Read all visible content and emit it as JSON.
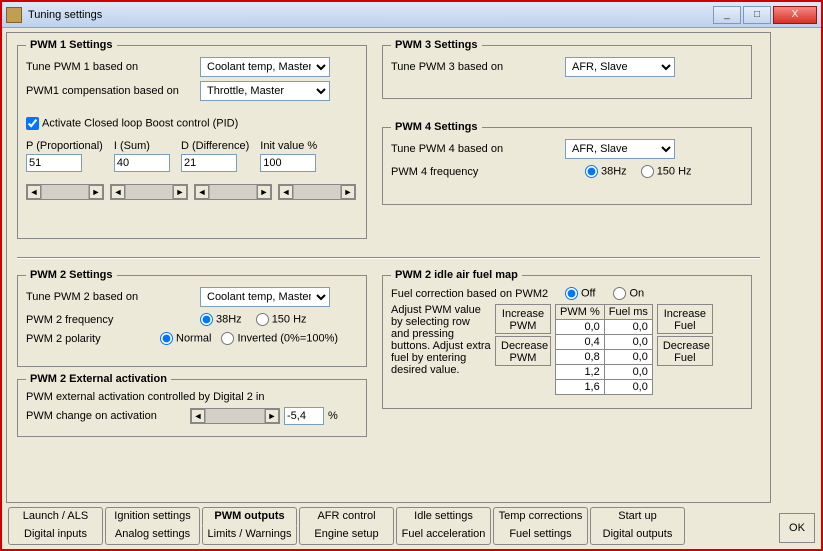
{
  "window": {
    "title": "Tuning settings",
    "buttons": {
      "min": "_",
      "max": "□",
      "close": "X"
    }
  },
  "pwm1": {
    "legend": "PWM 1 Settings",
    "baseLabel": "Tune PWM 1 based on",
    "baseValue": "Coolant temp, Master",
    "compLabel": "PWM1 compensation based on",
    "compValue": "Throttle, Master",
    "activateLabel": "Activate Closed loop Boost control  (PID)",
    "pid": {
      "p": {
        "label": "P (Proportional)",
        "value": "51"
      },
      "i": {
        "label": "I (Sum)",
        "value": "40"
      },
      "d": {
        "label": "D (Difference)",
        "value": "21"
      },
      "init": {
        "label": "Init value %",
        "value": "100"
      }
    }
  },
  "pwm3": {
    "legend": "PWM 3 Settings",
    "baseLabel": "Tune PWM 3 based on",
    "baseValue": "AFR, Slave"
  },
  "pwm4": {
    "legend": "PWM 4 Settings",
    "baseLabel": "Tune PWM 4 based on",
    "baseValue": "AFR, Slave",
    "freqLabel": "PWM 4 frequency",
    "freqOptions": {
      "a": "38Hz",
      "b": "150 Hz"
    }
  },
  "pwm2": {
    "legend": "PWM 2 Settings",
    "baseLabel": "Tune PWM 2 based on",
    "baseValue": "Coolant temp, Master",
    "freqLabel": "PWM 2 frequency",
    "freqOptions": {
      "a": "38Hz",
      "b": "150 Hz"
    },
    "polLabel": "PWM 2 polarity",
    "polOptions": {
      "a": "Normal",
      "b": "Inverted (0%=100%)"
    }
  },
  "pwm2ext": {
    "legend": "PWM 2 External activation",
    "desc": "PWM external activation controlled by Digital 2 in",
    "changeLabel": "PWM change on activation",
    "value": "-5,4",
    "unit": "%"
  },
  "pwm2idle": {
    "legend": "PWM 2 idle air fuel map",
    "corrLabel": "Fuel correction based on PWM2",
    "corrOptions": {
      "off": "Off",
      "on": "On"
    },
    "help1": "Adjust PWM value by selecting row and pressing buttons.",
    "help2": " Adjust extra fuel by entering desired value.",
    "btnIncP": "Increase PWM",
    "btnDecP": "Decrease PWM",
    "btnIncF": "Increase Fuel",
    "btnDecF": "Decrease Fuel",
    "headers": {
      "col1": "PWM %",
      "col2": "Fuel ms"
    },
    "rows": [
      {
        "pwm": "0,0",
        "fuel": "0,0"
      },
      {
        "pwm": "0,4",
        "fuel": "0,0"
      },
      {
        "pwm": "0,8",
        "fuel": "0,0"
      },
      {
        "pwm": "1,2",
        "fuel": "0,0"
      },
      {
        "pwm": "1,6",
        "fuel": "0,0"
      }
    ]
  },
  "tabsTop": [
    "Launch / ALS",
    "Ignition settings",
    "PWM outputs",
    "AFR control",
    "Idle settings",
    "Temp corrections",
    "Start up"
  ],
  "tabsBottom": [
    "Digital inputs",
    "Analog settings",
    "Limits / Warnings",
    "Engine setup",
    "Fuel acceleration",
    "Fuel settings",
    "Digital outputs"
  ],
  "activeTab": "PWM outputs",
  "okButton": "OK"
}
